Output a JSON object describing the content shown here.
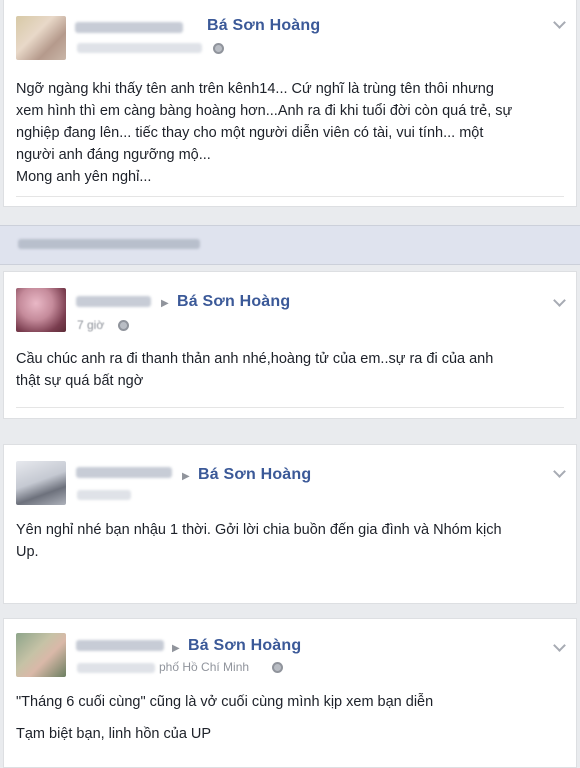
{
  "posts": [
    {
      "author": "",
      "target": "Bá Sơn Hoàng",
      "location": "",
      "text_lines": [
        "Ngỡ ngàng khi thấy tên anh trên kênh14... Cứ nghĩ là trùng tên thôi nhưng",
        "xem hình thì em càng bàng hoàng hơn...Anh ra đi khi tuổi đời còn quá trẻ, sự",
        "nghiệp đang lên... tiếc thay cho một người diễn viên có tài, vui tính... một",
        "người anh đáng ngưỡng mộ...",
        "Mong anh yên nghỉ..."
      ]
    },
    {
      "author": "",
      "target": "Bá Sơn Hoàng",
      "location": "",
      "timestamp": "7 giờ",
      "text_lines": [
        "Cầu chúc anh ra đi thanh thản anh nhé,hoàng tử của em..sự ra đi của anh",
        "thật sự quá bất ngờ"
      ]
    },
    {
      "author": "",
      "target": "Bá Sơn Hoàng",
      "location": "",
      "text_lines": [
        "Yên nghỉ nhé bạn nhậu 1 thời. Gởi lời chia buồn đến gia đình và Nhóm kịch",
        "Up."
      ]
    },
    {
      "author": "",
      "target": "Bá Sơn Hoàng",
      "location": "phố Hồ Chí Minh",
      "text_lines": [
        "\"Tháng 6 cuối cùng\" cũng là vở cuối cùng mình kịp xem bạn diễn",
        "Tạm biệt bạn, linh hồn của UP"
      ]
    }
  ],
  "colors": {
    "link": "#3b5998",
    "meta": "#90949c",
    "feed_bg": "#e9ebee"
  }
}
